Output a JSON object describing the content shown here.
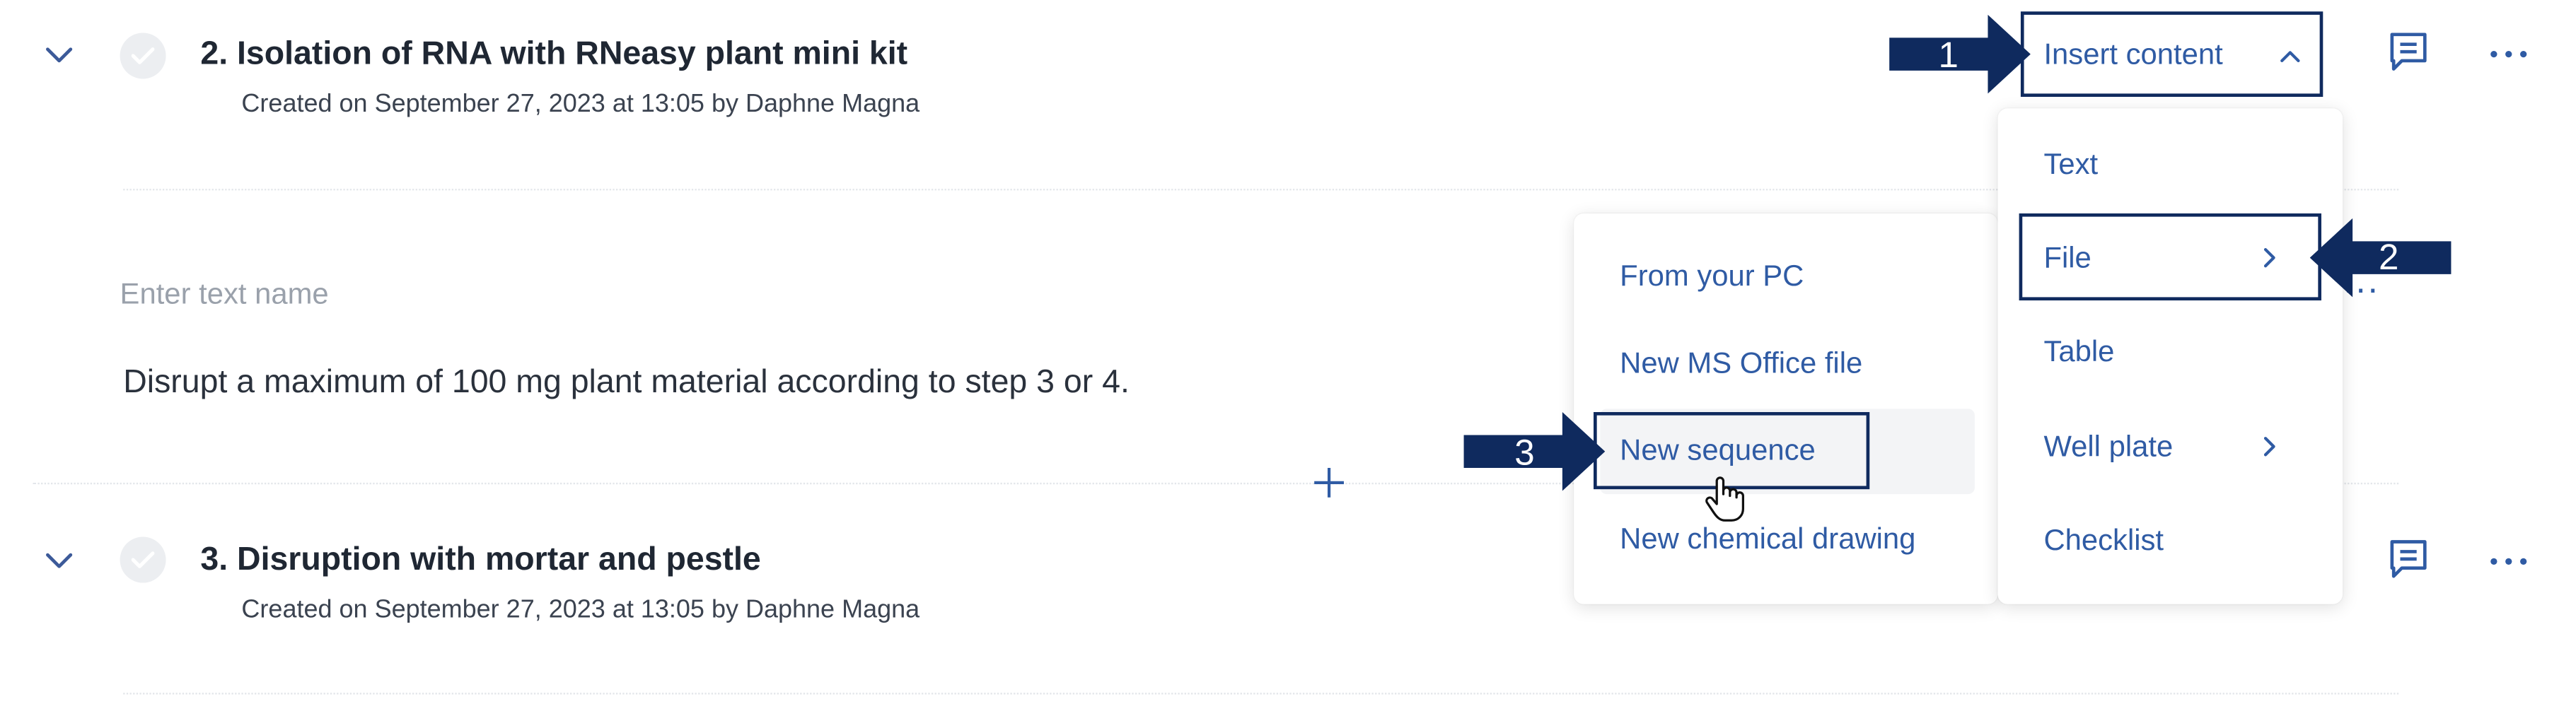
{
  "steps": [
    {
      "title": "2. Isolation of RNA with RNeasy plant mini kit",
      "meta": "Created on September 27, 2023 at 13:05 by Daphne Magna"
    },
    {
      "title": "3. Disruption with mortar and pestle",
      "meta": "Created on September 27, 2023 at 13:05 by Daphne Magna"
    }
  ],
  "text_block": {
    "name_placeholder": "Enter text name",
    "content": "Disrupt a maximum of 100 mg plant material according to step 3 or 4."
  },
  "insert_button": {
    "label": "Insert content"
  },
  "insert_menu": {
    "items": [
      {
        "label": "Text"
      },
      {
        "label": "File"
      },
      {
        "label": "Table"
      },
      {
        "label": "Well plate"
      },
      {
        "label": "Checklist"
      }
    ]
  },
  "file_submenu": {
    "items": [
      {
        "label": "From your PC"
      },
      {
        "label": "New MS Office file"
      },
      {
        "label": "New sequence"
      },
      {
        "label": "New chemical drawing"
      }
    ]
  },
  "annotations": {
    "arrow1": "1",
    "arrow2": "2",
    "arrow3": "3"
  },
  "colors": {
    "accent": "#2f5ba4",
    "annotation": "#0f2a5e",
    "title": "#1f2733"
  },
  "icons": [
    "chevron-down-icon",
    "check-icon",
    "comment-icon",
    "more-icon",
    "plus-icon",
    "chevron-up-icon",
    "chevron-right-icon",
    "hand-cursor-icon"
  ]
}
